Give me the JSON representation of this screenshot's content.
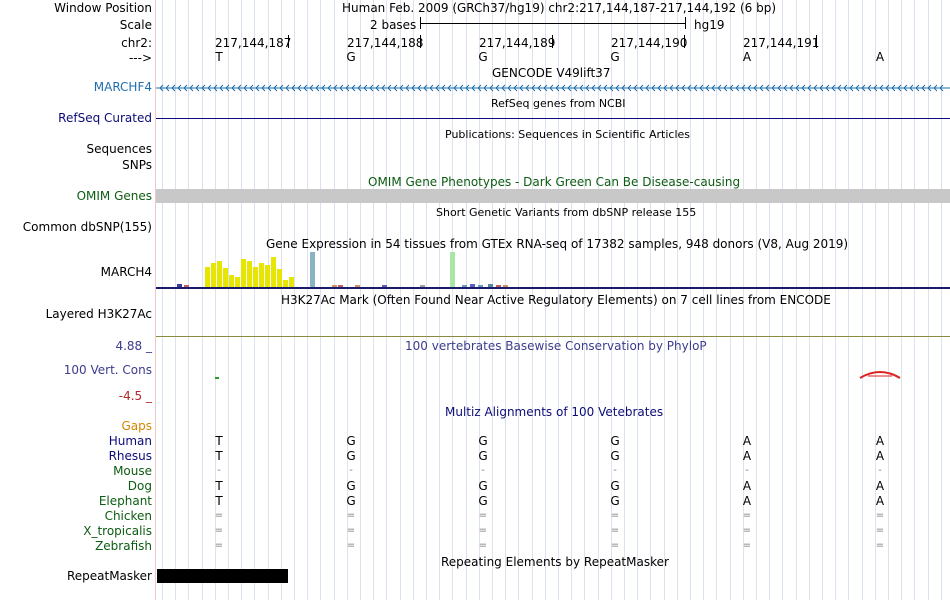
{
  "header": {
    "window_position_label": "Window Position",
    "window_position_value": "Human Feb. 2009 (GRCh37/hg19)   chr2:217,144,187-217,144,192 (6 bp)",
    "scale_label": "Scale",
    "scale_value": "2 bases",
    "scale_assembly": "hg19",
    "chr_label": "chr2:",
    "strand_label": "--->",
    "positions": [
      "217,144,187",
      "217,144,188",
      "217,144,189",
      "217,144,190",
      "217,144,191"
    ],
    "bases": [
      "T",
      "G",
      "G",
      "G",
      "A",
      "A"
    ]
  },
  "tracks": {
    "gencode": {
      "title": "GENCODE V49lift37",
      "gene_label": "MARCHF4"
    },
    "refseq": {
      "title": "RefSeq genes from NCBI",
      "label": "RefSeq Curated"
    },
    "publications": {
      "title": "Publications: Sequences in Scientific Articles",
      "label1": "Sequences",
      "label2": "SNPs"
    },
    "omim": {
      "title": "OMIM Gene Phenotypes - Dark Green Can Be Disease-causing",
      "label": "OMIM Genes"
    },
    "dbsnp": {
      "title": "Short Genetic Variants from dbSNP release 155",
      "label": "Common dbSNP(155)"
    },
    "gtex": {
      "title": "Gene Expression in 54 tissues from GTEx RNA-seq of 17382 samples, 948 donors (V8, Aug 2019)",
      "label": "MARCH4"
    },
    "h3k27ac": {
      "title": "H3K27Ac Mark (Often Found Near Active Regulatory Elements) on 7 cell lines from ENCODE",
      "label": "Layered H3K27Ac"
    },
    "phylop": {
      "title": "100 vertebrates Basewise Conservation by PhyloP",
      "label": "100 Vert. Cons",
      "max_label": "4.88 _",
      "min_label": "-4.5 _"
    },
    "multiz": {
      "title": "Multiz Alignments of 100 Vetebrates",
      "gaps_label": "Gaps",
      "species": [
        {
          "name": "Human",
          "bases": [
            "T",
            "G",
            "G",
            "G",
            "A",
            "A"
          ]
        },
        {
          "name": "Rhesus",
          "bases": [
            "T",
            "G",
            "G",
            "G",
            "A",
            "A"
          ]
        },
        {
          "name": "Mouse",
          "bases": [
            "-",
            "-",
            "-",
            "-",
            "-",
            "-"
          ]
        },
        {
          "name": "Dog",
          "bases": [
            "T",
            "G",
            "G",
            "G",
            "A",
            "A"
          ]
        },
        {
          "name": "Elephant",
          "bases": [
            "T",
            "G",
            "G",
            "G",
            "A",
            "A"
          ]
        },
        {
          "name": "Chicken",
          "bases": [
            "=",
            "=",
            "=",
            "=",
            "=",
            "="
          ]
        },
        {
          "name": "X_tropicalis",
          "bases": [
            "=",
            "=",
            "=",
            "=",
            "=",
            "="
          ]
        },
        {
          "name": "Zebrafish",
          "bases": [
            "=",
            "=",
            "=",
            "=",
            "=",
            "="
          ]
        }
      ]
    },
    "repeatmasker": {
      "title": "Repeating Elements by RepeatMasker",
      "label": "RepeatMasker"
    }
  },
  "colors": {
    "gencode": "#1e6fae",
    "refseq": "#0c0c78",
    "omim": "#0c5c12",
    "omim_bar": "#c8c8c8",
    "phylop": "#3c3c8c",
    "phylop_neg": "#b42828",
    "gaps": "#d48600",
    "species_primate": "#0c0c78",
    "species_other": "#0c5c12",
    "gtex_yellow": "#e6e600",
    "gtex_teal": "#8ab4c4",
    "gtex_green": "#a8e6a8"
  }
}
